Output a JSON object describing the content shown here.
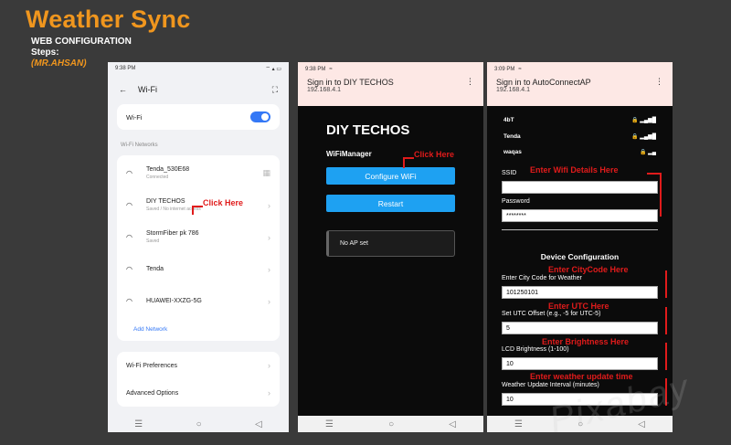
{
  "header": {
    "title": "Weather Sync",
    "subtitle_1": "WEB CONFIGURATION",
    "subtitle_2": "Steps:",
    "author": "(MR.AHSAN)"
  },
  "phone1": {
    "time": "9:38 PM",
    "status_icons": "⌔ ▴ ▭",
    "title": "Wi-Fi",
    "back_icon": "←",
    "scan_icon": "⛶",
    "wifi_toggle_label": "Wi-Fi",
    "wifi_enabled": true,
    "networks_label": "Wi-Fi Networks",
    "networks": [
      {
        "name": "Tenda_530E68",
        "status": "Connected"
      },
      {
        "name": "DIY TECHOS",
        "status": "Saved / No internet access"
      },
      {
        "name": "StormFiber pk 786",
        "status": "Saved"
      },
      {
        "name": "Tenda",
        "status": ""
      },
      {
        "name": "HUAWEI-XXZG-5G",
        "status": ""
      }
    ],
    "add_network": "Add Network",
    "preferences": "Wi-Fi Preferences",
    "advanced": "Advanced Options",
    "nav": [
      "☰",
      "○",
      "◁"
    ]
  },
  "phone2": {
    "time": "9:38 PM",
    "status_icons": "≈",
    "page_title": "Sign in to DIY TECHOS",
    "ip": "192.168.4.1",
    "menu_icon": "⋮",
    "heading": "DIY TECHOS",
    "subheading": "WiFiManager",
    "configure_button": "Configure WiFi",
    "restart_button": "Restart",
    "status_box": "No AP set",
    "nav": [
      "☰",
      "○",
      "◁"
    ]
  },
  "phone3": {
    "time": "3:09 PM",
    "status_icons": "≈",
    "page_title": "Sign in to AutoConnectAP",
    "ip": "192.168.4.1",
    "menu_icon": "⋮",
    "ap_list": [
      {
        "ssid": "4bT",
        "signal": "🔒 ▂▄▆█"
      },
      {
        "ssid": "Tenda",
        "signal": "🔒 ▂▄▆█"
      },
      {
        "ssid": "waqas",
        "signal": "🔒 ▂▄"
      }
    ],
    "ssid_label": "SSID",
    "ssid_value": "",
    "password_label": "Password",
    "password_value": "********",
    "section_title": "Device Configuration",
    "city_label": "Enter City Code for Weather",
    "city_value": "101250101",
    "utc_label": "Set UTC Offset (e.g., -5 for UTC-5)",
    "utc_value": "5",
    "brightness_label": "LCD Brightness (1-100)",
    "brightness_value": "10",
    "interval_label": "Weather Update Interval (minutes)",
    "interval_value": "10",
    "nav": [
      "☰",
      "○",
      "◁"
    ]
  },
  "annotations": {
    "click_here_1": "Click Here",
    "click_here_2": "Click Here",
    "wifi_details": "Enter Wifi Details Here",
    "city_code": "Enter CityCode Here",
    "utc": "Enter UTC Here",
    "brightness": "Enter Brightness Here",
    "weather_update": "Enter weather update time"
  },
  "watermark": "Pixabay",
  "colors": {
    "title": "#f0961e",
    "accent_blue": "#1ea1f2",
    "annotation_red": "#e01b1b",
    "toggle_blue": "#3478f6"
  }
}
